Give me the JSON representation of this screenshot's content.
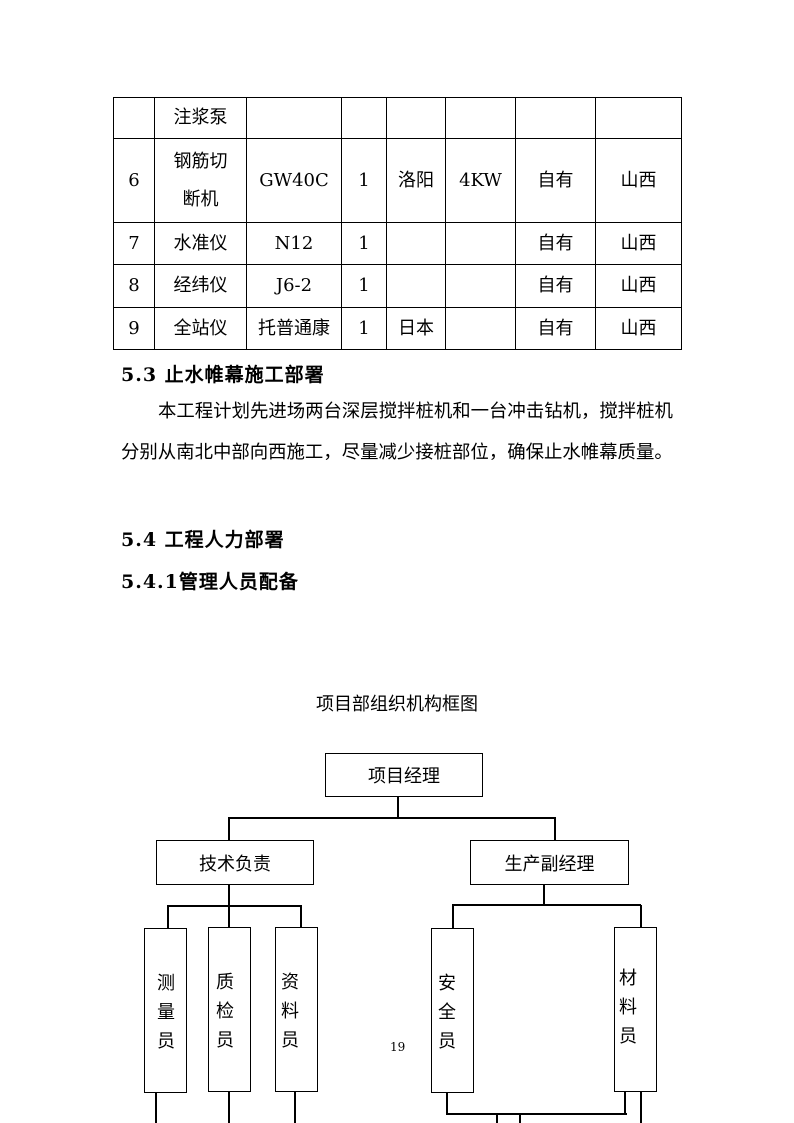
{
  "equipment_table": {
    "rows": [
      {
        "no": "",
        "name": "注浆泵",
        "model": "",
        "qty": "",
        "origin": "",
        "power": "",
        "owner": "",
        "location": ""
      },
      {
        "no": "6",
        "name_line1": "钢筋切",
        "name_line2": "断机",
        "model": "GW40C",
        "qty": "1",
        "origin": "洛阳",
        "power": "4KW",
        "owner": "自有",
        "location": "山西"
      },
      {
        "no": "7",
        "name": "水准仪",
        "model": "N12",
        "qty": "1",
        "origin": "",
        "power": "",
        "owner": "自有",
        "location": "山西"
      },
      {
        "no": "8",
        "name": "经纬仪",
        "model": "J6-2",
        "qty": "1",
        "origin": "",
        "power": "",
        "owner": "自有",
        "location": "山西"
      },
      {
        "no": "9",
        "name": "全站仪",
        "model": "托普通康",
        "qty": "1",
        "origin": "日本",
        "power": "",
        "owner": "自有",
        "location": "山西"
      }
    ]
  },
  "sections": {
    "s53_title": "5.3 止水帷幕施工部署",
    "s53_body": "本工程计划先进场两台深层搅拌桩机和一台冲击钻机，搅拌桩机分别从南北中部向西施工，尽量减少接桩部位，确保止水帷幕质量。",
    "s54_title": "5.4 工程人力部署",
    "s541_title": "5.4.1管理人员配备"
  },
  "org_chart": {
    "title": "项目部组织机构框图",
    "root": "项目经理",
    "left_head": "技术负责",
    "right_head": "生产副经理",
    "left_children": [
      "测量员",
      "质检员",
      "资料员"
    ],
    "right_children": [
      "安全员",
      "材料员"
    ]
  },
  "page_number": "19"
}
